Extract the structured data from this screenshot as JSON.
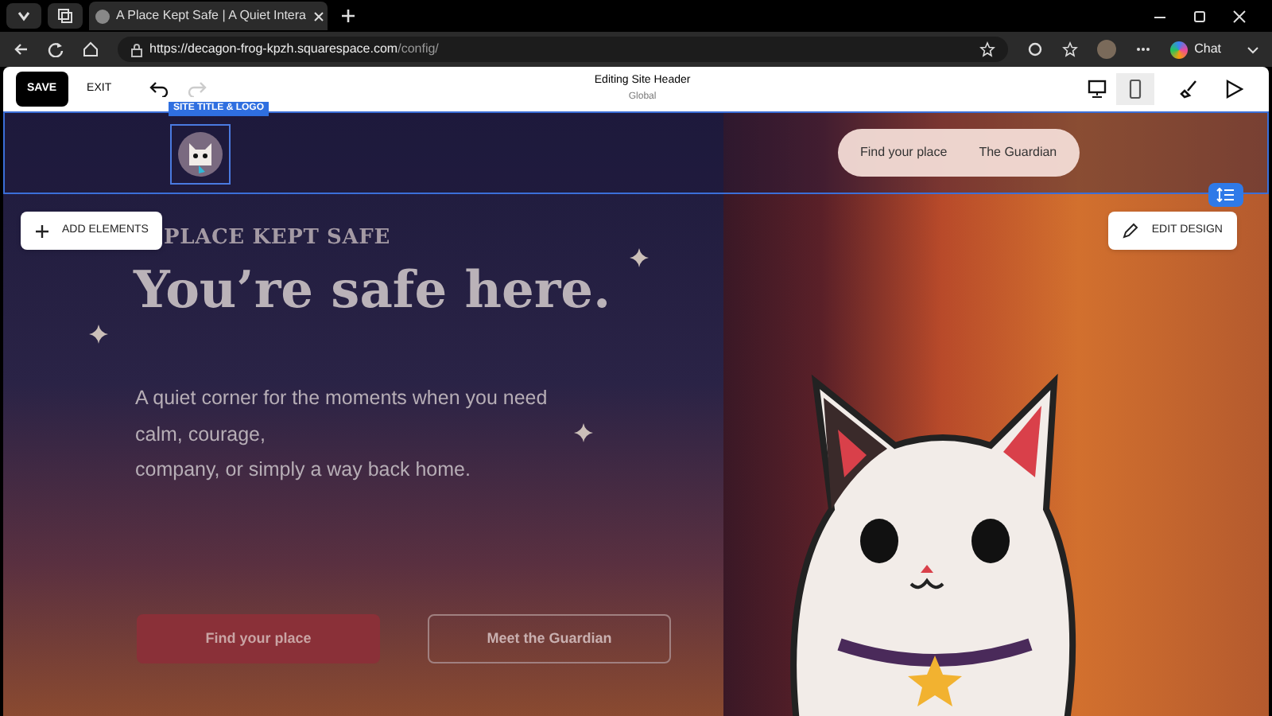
{
  "browser": {
    "tab_title": "A Place Kept Safe | A Quiet Intera",
    "url_host": "https://decagon-frog-kpzh.squarespace.com",
    "url_path": "/config/",
    "chat_label": "Chat"
  },
  "editor_bar": {
    "save": "SAVE",
    "exit": "EXIT",
    "title": "Editing Site Header",
    "subtitle": "Global",
    "views": [
      {
        "kind": "desktop",
        "selected": false
      },
      {
        "kind": "mobile",
        "selected": true
      }
    ]
  },
  "header": {
    "logo_tag": "SITE TITLE & LOGO",
    "nav": [
      "Find your place",
      "The Guardian"
    ]
  },
  "hero": {
    "add_elements": "ADD ELEMENTS",
    "edit_design": "EDIT DESIGN",
    "eyebrow": "PLACE KEPT SAFE",
    "heading": "You’re safe here.",
    "body_lines": [
      "A quiet corner for the moments when you need",
      "calm, courage,",
      "company, or simply a way back home."
    ],
    "buttons": [
      {
        "label": "Find your place",
        "kind": "primary"
      },
      {
        "label": "Meet the Guardian",
        "kind": "outline"
      }
    ]
  }
}
